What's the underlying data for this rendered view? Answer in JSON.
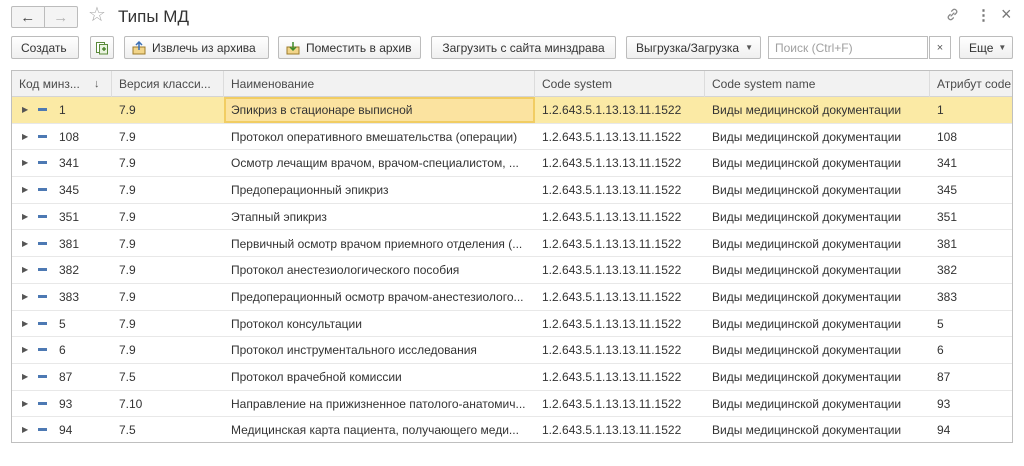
{
  "window": {
    "title": "Типы МД",
    "back_icon": "←",
    "forward_icon": "→",
    "favorite_icon": "☆",
    "link_icon": "🔗",
    "menu_icon": "⋮",
    "close_icon": "×"
  },
  "toolbar": {
    "create_label": "Создать",
    "extract_label": "Извлечь из архива",
    "archive_label": "Поместить в архив",
    "download_label": "Загрузить с сайта минздрава",
    "export_import_label": "Выгрузка/Загрузка",
    "search_placeholder": "Поиск (Ctrl+F)",
    "search_value": "",
    "clear_icon": "×",
    "more_label": "Еще"
  },
  "table": {
    "columns": [
      "Код минз...",
      "Версия класси...",
      "Наименование",
      "Code system",
      "Code system name",
      "Атрибут code"
    ],
    "sort_indicator": "↓",
    "selected_row_index": 0,
    "rows": [
      {
        "code": "1",
        "version": "7.9",
        "name": "Эпикриз в стационаре выписной",
        "code_system": "1.2.643.5.1.13.13.11.1522",
        "code_system_name": "Виды медицинской документации",
        "attr_code": "1"
      },
      {
        "code": "108",
        "version": "7.9",
        "name": "Протокол оперативного вмешательства (операции)",
        "code_system": "1.2.643.5.1.13.13.11.1522",
        "code_system_name": "Виды медицинской документации",
        "attr_code": "108"
      },
      {
        "code": "341",
        "version": "7.9",
        "name": "Осмотр лечащим врачом, врачом-специалистом, ...",
        "code_system": "1.2.643.5.1.13.13.11.1522",
        "code_system_name": "Виды медицинской документации",
        "attr_code": "341"
      },
      {
        "code": "345",
        "version": "7.9",
        "name": "Предоперационный эпикриз",
        "code_system": "1.2.643.5.1.13.13.11.1522",
        "code_system_name": "Виды медицинской документации",
        "attr_code": "345"
      },
      {
        "code": "351",
        "version": "7.9",
        "name": "Этапный эпикриз",
        "code_system": "1.2.643.5.1.13.13.11.1522",
        "code_system_name": "Виды медицинской документации",
        "attr_code": "351"
      },
      {
        "code": "381",
        "version": "7.9",
        "name": "Первичный осмотр врачом приемного отделения (...",
        "code_system": "1.2.643.5.1.13.13.11.1522",
        "code_system_name": "Виды медицинской документации",
        "attr_code": "381"
      },
      {
        "code": "382",
        "version": "7.9",
        "name": "Протокол анестезиологического пособия",
        "code_system": "1.2.643.5.1.13.13.11.1522",
        "code_system_name": "Виды медицинской документации",
        "attr_code": "382"
      },
      {
        "code": "383",
        "version": "7.9",
        "name": "Предоперационный осмотр врачом-анестезиолого...",
        "code_system": "1.2.643.5.1.13.13.11.1522",
        "code_system_name": "Виды медицинской документации",
        "attr_code": "383"
      },
      {
        "code": "5",
        "version": "7.9",
        "name": "Протокол консультации",
        "code_system": "1.2.643.5.1.13.13.11.1522",
        "code_system_name": "Виды медицинской документации",
        "attr_code": "5"
      },
      {
        "code": "6",
        "version": "7.9",
        "name": "Протокол инструментального исследования",
        "code_system": "1.2.643.5.1.13.13.11.1522",
        "code_system_name": "Виды медицинской документации",
        "attr_code": "6"
      },
      {
        "code": "87",
        "version": "7.5",
        "name": "Протокол врачебной комиссии",
        "code_system": "1.2.643.5.1.13.13.11.1522",
        "code_system_name": "Виды медицинской документации",
        "attr_code": "87"
      },
      {
        "code": "93",
        "version": "7.10",
        "name": "Направление на прижизненное патолого-анатомич...",
        "code_system": "1.2.643.5.1.13.13.11.1522",
        "code_system_name": "Виды медицинской документации",
        "attr_code": "93"
      },
      {
        "code": "94",
        "version": "7.5",
        "name": "Медицинская карта пациента, получающего меди...",
        "code_system": "1.2.643.5.1.13.13.11.1522",
        "code_system_name": "Виды медицинской документации",
        "attr_code": "94"
      }
    ]
  },
  "colors": {
    "selected_row": "#fbeaa5",
    "focus_border": "#f1cd63",
    "row_marker": "#4d79b3"
  }
}
